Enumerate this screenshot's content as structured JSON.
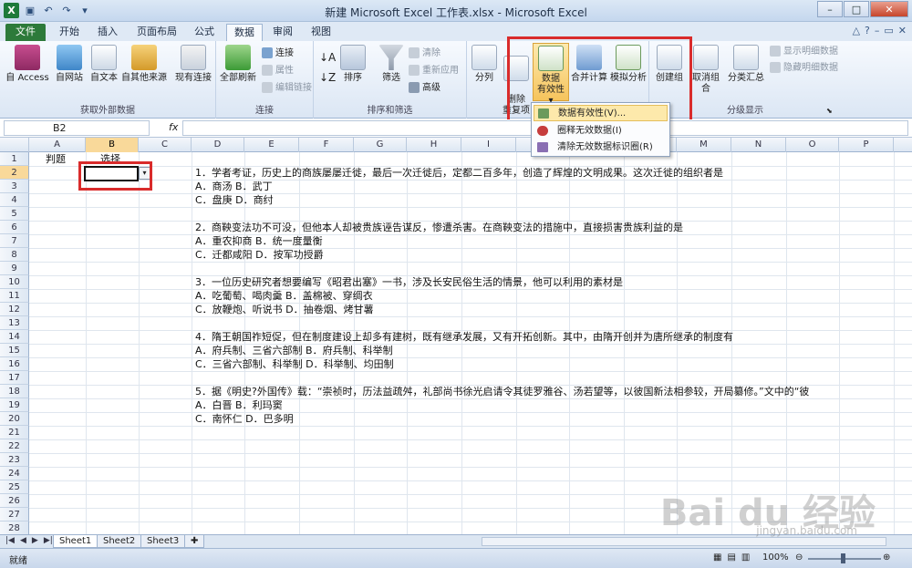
{
  "window": {
    "title": "新建 Microsoft Excel 工作表.xlsx - Microsoft Excel",
    "file_tab": "文件",
    "tabs": [
      "开始",
      "插入",
      "页面布局",
      "公式",
      "数据",
      "审阅",
      "视图"
    ],
    "active_tab": "数据"
  },
  "ribbon": {
    "get_external": {
      "access": "自 Access",
      "web": "自网站",
      "text": "自文本",
      "other": "自其他来源",
      "existing": "现有连接",
      "label": "获取外部数据"
    },
    "connections": {
      "refresh_all": "全部刷新",
      "connections": "连接",
      "properties": "属性",
      "edit_links": "编辑链接",
      "label": "连接"
    },
    "sort_filter": {
      "sort": "排序",
      "filter": "筛选",
      "clear": "清除",
      "reapply": "重新应用",
      "advanced": "高级",
      "label": "排序和筛选"
    },
    "data_tools": {
      "text_to_columns": "分列",
      "remove_dup": "删除\n重复项",
      "validation_l1": "数据",
      "validation_l2": "有效性",
      "consolidate": "合并计算",
      "whatif": "模拟分析"
    },
    "outline": {
      "group": "创建组",
      "ungroup": "取消组合",
      "subtotal": "分类汇总",
      "show_detail": "显示明细数据",
      "hide_detail": "隐藏明细数据",
      "label": "分级显示"
    }
  },
  "dropdown": {
    "items": [
      "数据有效性(V)...",
      "圈释无效数据(I)",
      "清除无效数据标识圈(R)"
    ]
  },
  "formula_bar": {
    "name_box": "B2",
    "fx": "fx",
    "content": ""
  },
  "columns": [
    "A",
    "B",
    "C",
    "D",
    "E",
    "F",
    "G",
    "H",
    "I",
    "J",
    "K",
    "L",
    "M",
    "N",
    "O",
    "P"
  ],
  "rows": [
    "1",
    "2",
    "3",
    "4",
    "5",
    "6",
    "7",
    "8",
    "9",
    "10",
    "11",
    "12",
    "13",
    "14",
    "15",
    "16",
    "17",
    "18",
    "19",
    "20",
    "21",
    "22",
    "23",
    "24",
    "25",
    "26",
    "27",
    "28"
  ],
  "cells": {
    "a1": "判题",
    "b1": "选择",
    "d2": "1．学者考证，历史上的商族屡屡迁徙，最后一次迁徙后，定都二百多年，创造了辉煌的文明成果。这次迁徙的组织者是",
    "d3": "A．商汤 B．武丁",
    "d4": "C．盘庚 D．商纣",
    "d6": "2．商鞅变法功不可没，但他本人却被贵族诬告谋反，惨遭杀害。在商鞅变法的措施中，直接损害贵族利益的是",
    "d7": "A．重农抑商 B．统一度量衡",
    "d8": "C．迁都咸阳 D．按军功授爵",
    "d10": "3．一位历史研究者想要编写《昭君出塞》一书，涉及长安民俗生活的情景，他可以利用的素材是",
    "d11": "A．吃葡萄、喝肉羹 B．盖棉被、穿绸衣",
    "d12": "C．放鞭炮、听说书 D．抽卷烟、烤甘薯",
    "d14": "4．隋王朝国祚短促，但在制度建设上却多有建树，既有继承发展，又有开拓创新。其中，由隋开创并为唐所继承的制度有",
    "d15": "A．府兵制、三省六部制 B．府兵制、科举制",
    "d16": "C．三省六部制、科举制 D．科举制、均田制",
    "d18": "5．据《明史?外国传》载：“崇祯时，历法益疏舛，礼部尚书徐光启请令其徒罗雅谷、汤若望等，以彼国新法相参较，开局纂修。”文中的“彼",
    "d19": "A．白晋 B．利玛窦",
    "d20": "C．南怀仁 D．巴多明"
  },
  "sheets": [
    "Sheet1",
    "Sheet2",
    "Sheet3"
  ],
  "status": {
    "ready": "就绪",
    "zoom": "100%"
  },
  "watermark": {
    "main": "Bai du 经验",
    "sub": "jingyan.baidu.com"
  }
}
